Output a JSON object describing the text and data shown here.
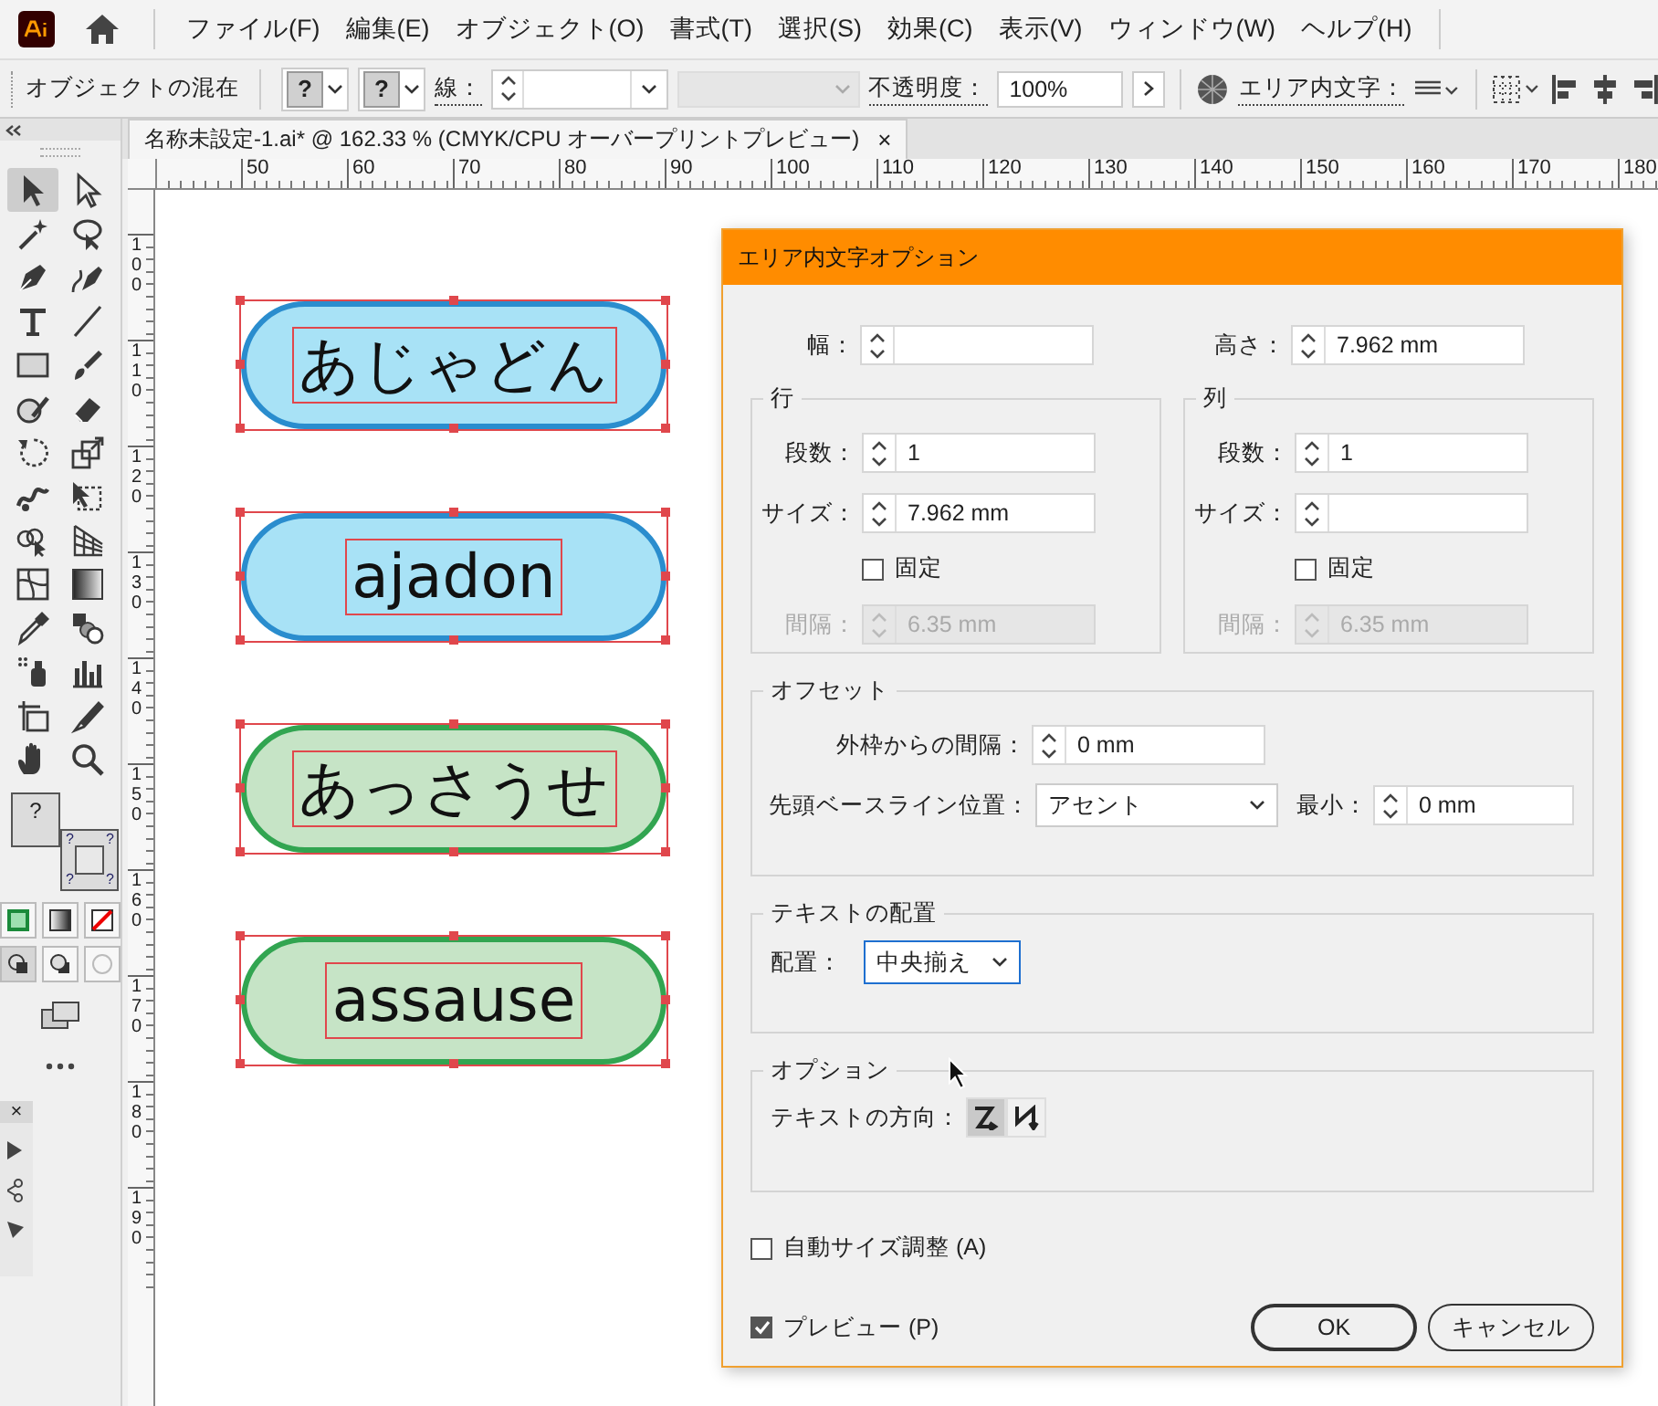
{
  "app_menu": {
    "items": [
      "ファイル(F)",
      "編集(E)",
      "オブジェクト(O)",
      "書式(T)",
      "選択(S)",
      "効果(C)",
      "表示(V)",
      "ウィンドウ(W)",
      "ヘルプ(H)"
    ]
  },
  "control_bar": {
    "selection_label": "オブジェクトの混在",
    "fill_swatch": "?",
    "stroke_swatch": "?",
    "stroke_label": "線：",
    "opacity_label": "不透明度：",
    "opacity_value": "100%",
    "area_type_label": "エリア内文字："
  },
  "document_tab": {
    "title": "名称未設定-1.ai* @ 162.33 % (CMYK/CPU オーバープリントプレビュー)",
    "close": "×"
  },
  "ruler": {
    "horizontal": [
      "50",
      "60",
      "70",
      "80",
      "90",
      "100",
      "110",
      "120",
      "130",
      "140",
      "150",
      "160",
      "170",
      "180"
    ],
    "vertical": [
      "100",
      "110",
      "120",
      "130",
      "140",
      "150",
      "160",
      "170",
      "180",
      "190"
    ]
  },
  "tools": [
    {
      "selected": true
    },
    {
      "selected": false
    },
    {
      "selected": false
    },
    {
      "selected": false
    },
    {
      "selected": false
    },
    {
      "selected": false
    },
    {
      "selected": false
    },
    {
      "selected": false
    },
    {
      "selected": false
    },
    {
      "selected": false
    },
    {
      "selected": false
    },
    {
      "selected": false
    },
    {
      "selected": false
    },
    {
      "selected": false
    },
    {
      "selected": false
    },
    {
      "selected": false
    },
    {
      "selected": false
    },
    {
      "selected": false
    },
    {
      "selected": false
    },
    {
      "selected": false
    },
    {
      "selected": false
    },
    {
      "selected": false
    },
    {
      "selected": false
    },
    {
      "selected": false
    },
    {
      "selected": false
    },
    {
      "selected": false
    },
    {
      "selected": false
    },
    {
      "selected": false
    }
  ],
  "fill_stroke": {
    "fill_mark": "?",
    "stroke_marks": [
      "?",
      "?",
      "?",
      "?"
    ]
  },
  "mini_panel": {
    "close": "×"
  },
  "artboard": {
    "shapes": [
      {
        "text": "あじゃどん",
        "color": "#a8e2f6"
      },
      {
        "text": "ajadon",
        "color": "#a8e2f6"
      },
      {
        "text": "あっさうせ",
        "color": "#c6e4c6"
      },
      {
        "text": "assause",
        "color": "#c6e4c6"
      }
    ]
  },
  "dialog": {
    "title": "エリア内文字オプション",
    "width": {
      "label": "幅："
    },
    "height": {
      "label": "高さ：",
      "value": "7.962 mm"
    },
    "rows": {
      "legend": "行",
      "count": {
        "label": "段数：",
        "value": "1"
      },
      "size": {
        "label": "サイズ：",
        "value": "7.962 mm"
      },
      "fixed": {
        "label": "固定",
        "checked": false
      },
      "gutter": {
        "label": "間隔：",
        "value": "6.35 mm",
        "disabled": true
      }
    },
    "columns": {
      "legend": "列",
      "count": {
        "label": "段数：",
        "value": "1"
      },
      "size": {
        "label": "サイズ："
      },
      "fixed": {
        "label": "固定",
        "checked": false
      },
      "gutter": {
        "label": "間隔：",
        "value": "6.35 mm",
        "disabled": true
      }
    },
    "offset": {
      "legend": "オフセット",
      "inset": {
        "label": "外枠からの間隔：",
        "value": "0 mm"
      },
      "first_baseline": {
        "label": "先頭ベースライン位置：",
        "value": "アセント"
      },
      "min": {
        "label": "最小：",
        "value": "0 mm"
      }
    },
    "alignment": {
      "legend": "テキストの配置",
      "align": {
        "label": "配置：",
        "value": "中央揃え",
        "focused": true
      }
    },
    "options": {
      "legend": "オプション",
      "direction_label": "テキストの方向：",
      "directions": [
        {
          "selected": true
        },
        {
          "selected": false
        }
      ]
    },
    "auto_size": {
      "label": "自動サイズ調整 (A)",
      "checked": false
    },
    "preview": {
      "label": "プレビュー (P)",
      "checked": true
    },
    "buttons": [
      {
        "label": "OK",
        "kind": "default"
      },
      {
        "label": "キャンセル",
        "kind": "normal"
      }
    ]
  }
}
